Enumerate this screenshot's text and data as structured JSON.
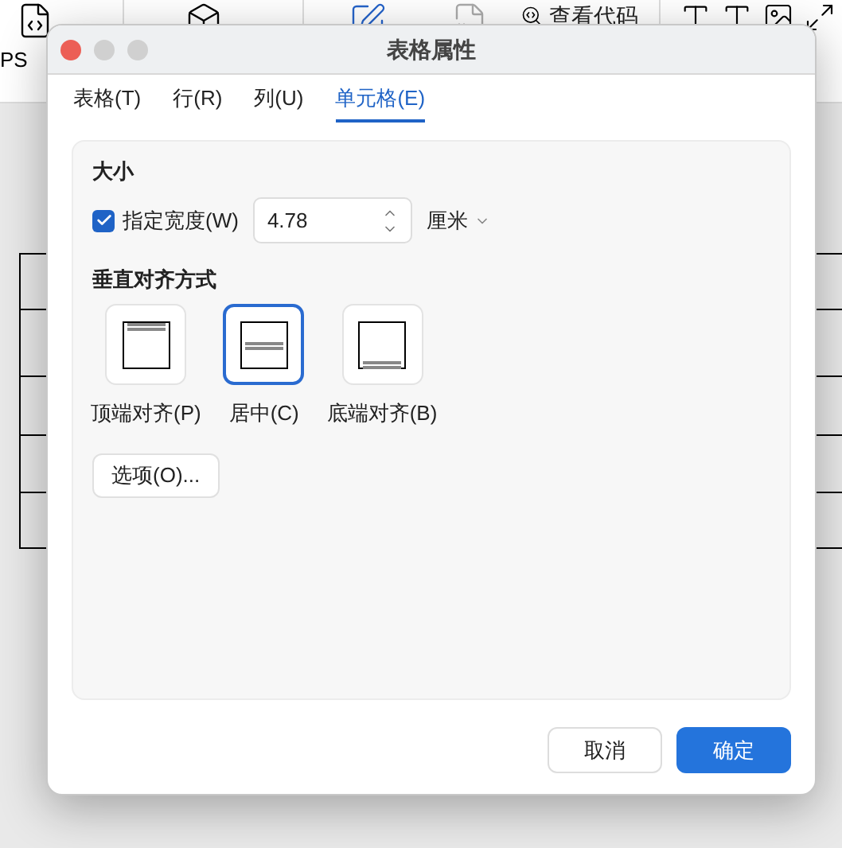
{
  "toolbar": {
    "labels": [
      "PS",
      "查看代码"
    ]
  },
  "dialog": {
    "title": "表格属性",
    "tabs": [
      {
        "label": "表格(T)",
        "selected": false
      },
      {
        "label": "行(R)",
        "selected": false
      },
      {
        "label": "列(U)",
        "selected": false
      },
      {
        "label": "单元格(E)",
        "selected": true
      }
    ],
    "size": {
      "heading": "大小",
      "width_checkbox": {
        "label": "指定宽度(W)",
        "checked": true
      },
      "width_field": {
        "value": "4.78"
      },
      "unit": "厘米"
    },
    "vertical_alignment": {
      "heading": "垂直对齐方式",
      "options": [
        {
          "kind": "top",
          "label": "顶端对齐(P)",
          "selected": false
        },
        {
          "kind": "center",
          "label": "居中(C)",
          "selected": true
        },
        {
          "kind": "bottom",
          "label": "底端对齐(B)",
          "selected": false
        }
      ]
    },
    "options_button": "选项(O)...",
    "buttons": [
      {
        "kind": "secondary",
        "label": "取消"
      },
      {
        "kind": "primary",
        "label": "确定"
      }
    ]
  }
}
